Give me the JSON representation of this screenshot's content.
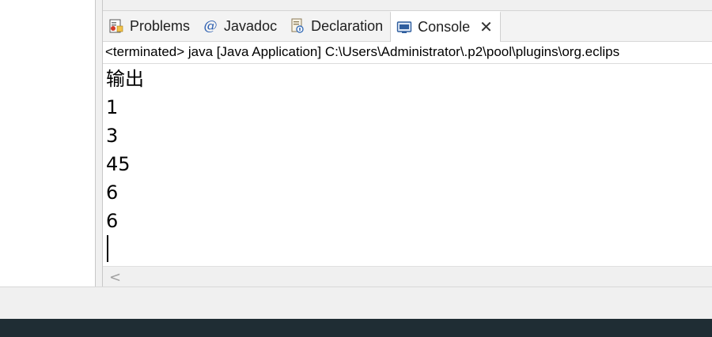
{
  "tabs": [
    {
      "label": "Problems",
      "icon": "problems-icon"
    },
    {
      "label": "Javadoc",
      "icon": "javadoc-icon"
    },
    {
      "label": "Declaration",
      "icon": "declaration-icon"
    },
    {
      "label": "Console",
      "icon": "console-icon",
      "active": true
    }
  ],
  "close_glyph": "✕",
  "status_line": "<terminated> java [Java Application] C:\\Users\\Administrator\\.p2\\pool\\plugins\\org.eclips",
  "console_output": [
    "输出",
    "1",
    "3",
    "45",
    "6",
    "6"
  ],
  "scroll_left_glyph": "<",
  "colors": {
    "taskbar": "#1f2d34",
    "console_text": "#000000",
    "javadoc_at": "#2a5db0"
  }
}
